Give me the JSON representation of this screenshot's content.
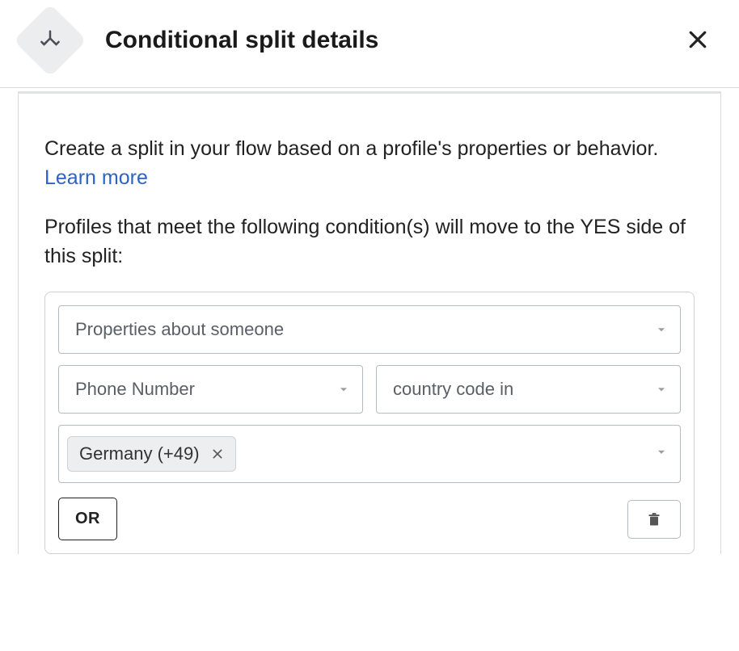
{
  "header": {
    "title": "Conditional split details"
  },
  "intro": {
    "text_before": "Create a split in your flow based on a profile's properties or behavior. ",
    "learn_more": "Learn more"
  },
  "condition_heading": "Profiles that meet the following condition(s) will move to the YES side of this split:",
  "condition": {
    "type_select": "Properties about someone",
    "property_select": "Phone Number",
    "operator_select": "country code in",
    "values": [
      "Germany (+49)"
    ]
  },
  "buttons": {
    "or": "OR"
  }
}
